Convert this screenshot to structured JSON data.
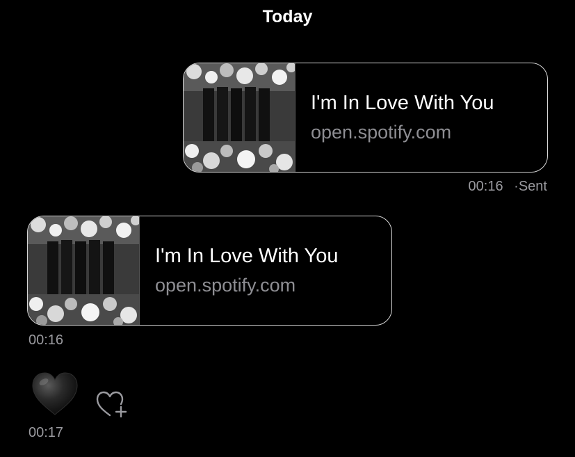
{
  "header": {
    "day_label": "Today"
  },
  "messages": [
    {
      "direction": "sent",
      "link_title": "I'm In Love With You",
      "link_domain": "open.spotify.com",
      "time": "00:16",
      "status": "Sent",
      "status_separator": "·"
    },
    {
      "direction": "received",
      "link_title": "I'm In Love With You",
      "link_domain": "open.spotify.com",
      "time": "00:16"
    },
    {
      "direction": "received",
      "emoji": "black-heart",
      "time": "00:17"
    }
  ],
  "colors": {
    "background": "#000000",
    "card_border": "#d6d6d6",
    "primary_text": "#ffffff",
    "secondary_text": "#8e8e93"
  }
}
